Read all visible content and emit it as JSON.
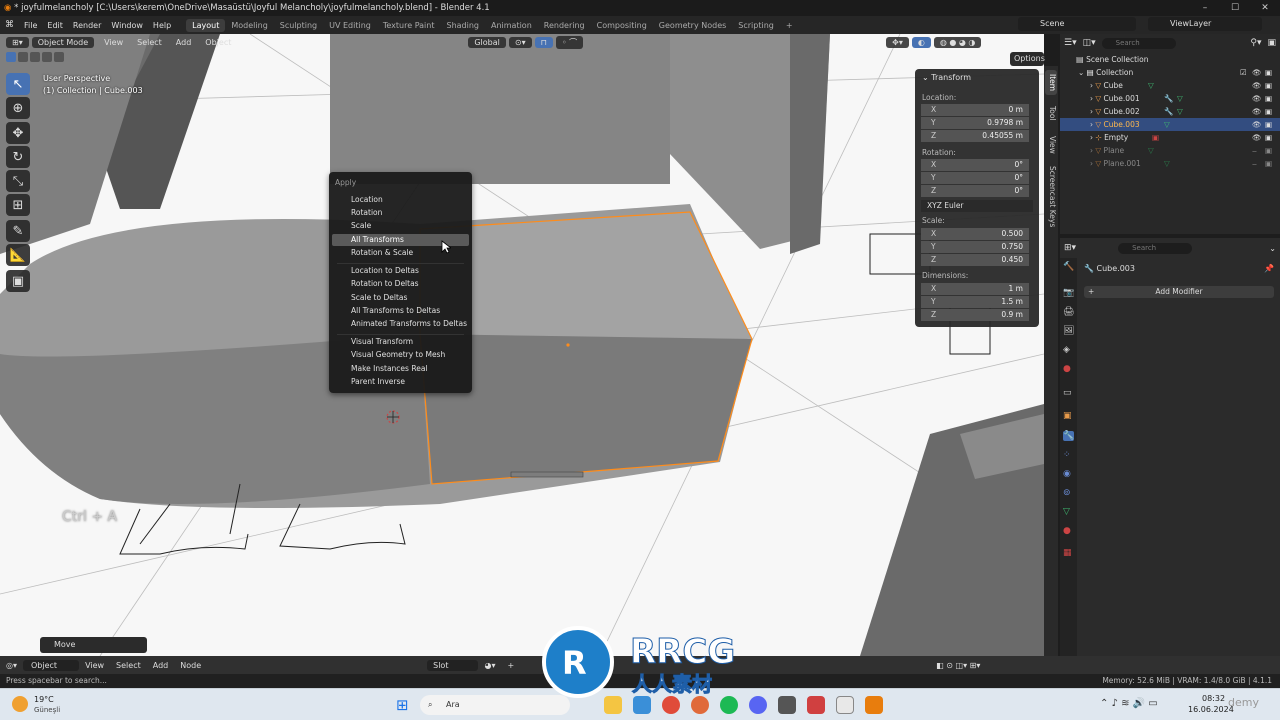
{
  "window": {
    "title": "* joyfulmelancholy [C:\\Users\\kerem\\OneDrive\\Masaüstü\\Joyful Melancholy\\joyfulmelancholy.blend] - Blender 4.1",
    "controls": [
      "–",
      "☐",
      "✕"
    ]
  },
  "menubar": {
    "menus": [
      "File",
      "Edit",
      "Render",
      "Window",
      "Help"
    ],
    "workspaces": [
      "Layout",
      "Modeling",
      "Sculpting",
      "UV Editing",
      "Texture Paint",
      "Shading",
      "Animation",
      "Rendering",
      "Compositing",
      "Geometry Nodes",
      "Scripting"
    ],
    "active_workspace": "Layout",
    "add_workspace": "+",
    "scene": "Scene",
    "view_layer": "ViewLayer"
  },
  "viewport_header": {
    "mode": "Object Mode",
    "menus": [
      "View",
      "Select",
      "Add",
      "Object"
    ],
    "transform_orientation": "Global",
    "options": "Options"
  },
  "viewport": {
    "perspective": "User Perspective",
    "collection_info": "(1) Collection | Cube.003",
    "shortcut_overlay": "Ctrl + A",
    "last_operator": "Move"
  },
  "context_menu": {
    "title": "Apply",
    "items": [
      {
        "label": "Location",
        "highlighted": false
      },
      {
        "label": "Rotation",
        "highlighted": false
      },
      {
        "label": "Scale",
        "highlighted": false
      },
      {
        "label": "All Transforms",
        "highlighted": true
      },
      {
        "label": "Rotation & Scale",
        "highlighted": false
      },
      {
        "label": "Location to Deltas",
        "highlighted": false
      },
      {
        "label": "Rotation to Deltas",
        "highlighted": false
      },
      {
        "label": "Scale to Deltas",
        "highlighted": false
      },
      {
        "label": "All Transforms to Deltas",
        "highlighted": false
      },
      {
        "label": "Animated Transforms to Deltas",
        "highlighted": false
      },
      {
        "label": "Visual Transform",
        "highlighted": false
      },
      {
        "label": "Visual Geometry to Mesh",
        "highlighted": false
      },
      {
        "label": "Make Instances Real",
        "highlighted": false
      },
      {
        "label": "Parent Inverse",
        "highlighted": false
      }
    ]
  },
  "n_panel": {
    "header": "Transform",
    "location_label": "Location:",
    "location": [
      {
        "axis": "X",
        "value": "0 m"
      },
      {
        "axis": "Y",
        "value": "0.9798 m"
      },
      {
        "axis": "Z",
        "value": "0.45055 m"
      }
    ],
    "rotation_label": "Rotation:",
    "rotation": [
      {
        "axis": "X",
        "value": "0°"
      },
      {
        "axis": "Y",
        "value": "0°"
      },
      {
        "axis": "Z",
        "value": "0°"
      }
    ],
    "rotation_mode": "XYZ Euler",
    "scale_label": "Scale:",
    "scale": [
      {
        "axis": "X",
        "value": "0.500"
      },
      {
        "axis": "Y",
        "value": "0.750"
      },
      {
        "axis": "Z",
        "value": "0.450"
      }
    ],
    "dimensions_label": "Dimensions:",
    "dimensions": [
      {
        "axis": "X",
        "value": "1 m"
      },
      {
        "axis": "Y",
        "value": "1.5 m"
      },
      {
        "axis": "Z",
        "value": "0.9 m"
      }
    ],
    "tabs": [
      "Item",
      "Tool",
      "View",
      "Screencast Keys"
    ]
  },
  "outliner": {
    "search_placeholder": "Search",
    "scene_collection": "Scene Collection",
    "collection": "Collection",
    "items": [
      {
        "name": "Cube",
        "selected": false,
        "dim": false
      },
      {
        "name": "Cube.001",
        "selected": false,
        "dim": false
      },
      {
        "name": "Cube.002",
        "selected": false,
        "dim": false
      },
      {
        "name": "Cube.003",
        "selected": true,
        "dim": false
      },
      {
        "name": "Empty",
        "selected": false,
        "dim": false
      },
      {
        "name": "Plane",
        "selected": false,
        "dim": true
      },
      {
        "name": "Plane.001",
        "selected": false,
        "dim": true
      }
    ]
  },
  "properties": {
    "search_placeholder": "Search",
    "object_name": "Cube.003",
    "add_modifier": "Add Modifier"
  },
  "bottom_header": {
    "editor": "Object",
    "menus": [
      "View",
      "Select",
      "Add",
      "Node"
    ],
    "slot": "Slot",
    "new": "+"
  },
  "status_bar": {
    "hint": "Press spacebar to search...",
    "memory": "Memory: 52.6 MiB | VRAM: 1.4/8.0 GiB | 4.1.1"
  },
  "taskbar": {
    "weather_temp": "19°C",
    "weather_desc": "Güneşli",
    "search": "Ara",
    "time": "08:32",
    "date": "16.06.2024"
  },
  "watermark": {
    "brand": "RRCG",
    "sub": "人人素材",
    "corner": "demy"
  },
  "colors": {
    "accent": "#4772b3",
    "selection": "#ff8c1a",
    "highlight": "#5a5a5a"
  }
}
